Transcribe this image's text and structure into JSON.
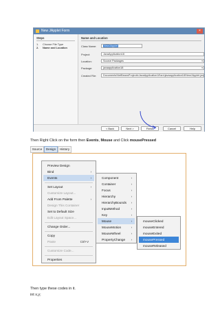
{
  "dialog": {
    "title": "New JApplet Form",
    "close_glyph": "×",
    "steps_title": "Steps",
    "steps": [
      {
        "num": "1.",
        "label": "Choose File Type"
      },
      {
        "num": "2.",
        "label": "Name and Location"
      }
    ],
    "panel_title": "Name and Location",
    "class_name_label": "Class Name:",
    "class_name_value": "NewJApplet",
    "project_label": "Project:",
    "project_value": "JavaApplication18",
    "location_label": "Location:",
    "location_value": "Source Packages",
    "package_label": "Package:",
    "package_value": "javaapplication18",
    "created_file_label": "Created File:",
    "created_file_value": "Documents\\NetBeansProjects\\JavaApplication18\\src\\javaapplication18\\NewJApplet.java",
    "buttons": {
      "back": "< Back",
      "next": "Next >",
      "finish": "Finish",
      "cancel": "Cancel",
      "help": "Help"
    }
  },
  "instruction": {
    "pre": "Then Right Click on the form then ",
    "events": "Events",
    "mid1": ", ",
    "mouse": "Mouse",
    "mid2": " and Click ",
    "pressed": "mousePressed"
  },
  "editor_tabs": [
    "Source",
    "Design",
    "History"
  ],
  "menu_main": [
    {
      "label": "Preview Design",
      "submenu": false,
      "disabled": false
    },
    {
      "label": "Bind",
      "submenu": true,
      "disabled": false
    },
    {
      "label": "Events",
      "submenu": true,
      "disabled": false
    },
    {
      "label": "Set Layout",
      "submenu": true,
      "disabled": false
    },
    {
      "label": "Customize Layout...",
      "submenu": false,
      "disabled": true
    },
    {
      "label": "Add From Palette",
      "submenu": true,
      "disabled": false
    },
    {
      "label": "Design This Container",
      "submenu": false,
      "disabled": true
    },
    {
      "label": "Set to Default Size",
      "submenu": false,
      "disabled": false
    },
    {
      "label": "Edit Layout Space...",
      "submenu": false,
      "disabled": true
    },
    {
      "label": "Change Order...",
      "submenu": false,
      "disabled": false
    },
    {
      "label": "Copy",
      "submenu": false,
      "disabled": false
    },
    {
      "label": "Paste",
      "submenu": false,
      "disabled": true,
      "shortcut": "Ctrl+V"
    },
    {
      "label": "Customize Code...",
      "submenu": false,
      "disabled": true
    },
    {
      "label": "Properties",
      "submenu": false,
      "disabled": false
    }
  ],
  "menu_events": [
    "Component",
    "Container",
    "Focus",
    "Hierarchy",
    "HierarchyBounds",
    "InputMethod",
    "Key",
    "Mouse",
    "MouseMotion",
    "MouseWheel",
    "PropertyChange"
  ],
  "menu_mouse": [
    "mouseClicked",
    "mouseEntered",
    "mouseExited",
    "mousePressed",
    "mouseReleased"
  ],
  "submenu_glyph": "›",
  "outro_text": "Then type these codes in it.",
  "code_line": "int x,y;",
  "colors": {
    "menu_highlight": "#c8daf0",
    "menu_selected": "#3d86d8",
    "frame_border": "#e3ad68",
    "dialog_title": "#5f88b6"
  }
}
